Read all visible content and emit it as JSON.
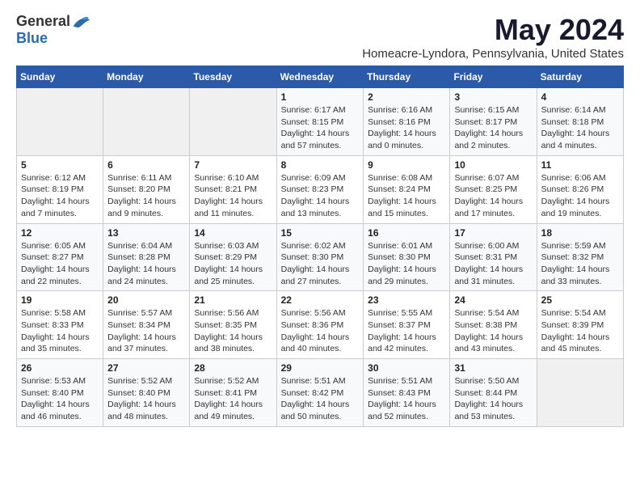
{
  "header": {
    "logo_general": "General",
    "logo_blue": "Blue",
    "title": "May 2024",
    "subtitle": "Homeacre-Lyndora, Pennsylvania, United States"
  },
  "calendar": {
    "days_of_week": [
      "Sunday",
      "Monday",
      "Tuesday",
      "Wednesday",
      "Thursday",
      "Friday",
      "Saturday"
    ],
    "weeks": [
      [
        {
          "day": "",
          "info": ""
        },
        {
          "day": "",
          "info": ""
        },
        {
          "day": "",
          "info": ""
        },
        {
          "day": "1",
          "info": "Sunrise: 6:17 AM\nSunset: 8:15 PM\nDaylight: 14 hours\nand 57 minutes."
        },
        {
          "day": "2",
          "info": "Sunrise: 6:16 AM\nSunset: 8:16 PM\nDaylight: 14 hours\nand 0 minutes."
        },
        {
          "day": "3",
          "info": "Sunrise: 6:15 AM\nSunset: 8:17 PM\nDaylight: 14 hours\nand 2 minutes."
        },
        {
          "day": "4",
          "info": "Sunrise: 6:14 AM\nSunset: 8:18 PM\nDaylight: 14 hours\nand 4 minutes."
        }
      ],
      [
        {
          "day": "5",
          "info": "Sunrise: 6:12 AM\nSunset: 8:19 PM\nDaylight: 14 hours\nand 7 minutes."
        },
        {
          "day": "6",
          "info": "Sunrise: 6:11 AM\nSunset: 8:20 PM\nDaylight: 14 hours\nand 9 minutes."
        },
        {
          "day": "7",
          "info": "Sunrise: 6:10 AM\nSunset: 8:21 PM\nDaylight: 14 hours\nand 11 minutes."
        },
        {
          "day": "8",
          "info": "Sunrise: 6:09 AM\nSunset: 8:23 PM\nDaylight: 14 hours\nand 13 minutes."
        },
        {
          "day": "9",
          "info": "Sunrise: 6:08 AM\nSunset: 8:24 PM\nDaylight: 14 hours\nand 15 minutes."
        },
        {
          "day": "10",
          "info": "Sunrise: 6:07 AM\nSunset: 8:25 PM\nDaylight: 14 hours\nand 17 minutes."
        },
        {
          "day": "11",
          "info": "Sunrise: 6:06 AM\nSunset: 8:26 PM\nDaylight: 14 hours\nand 19 minutes."
        }
      ],
      [
        {
          "day": "12",
          "info": "Sunrise: 6:05 AM\nSunset: 8:27 PM\nDaylight: 14 hours\nand 22 minutes."
        },
        {
          "day": "13",
          "info": "Sunrise: 6:04 AM\nSunset: 8:28 PM\nDaylight: 14 hours\nand 24 minutes."
        },
        {
          "day": "14",
          "info": "Sunrise: 6:03 AM\nSunset: 8:29 PM\nDaylight: 14 hours\nand 25 minutes."
        },
        {
          "day": "15",
          "info": "Sunrise: 6:02 AM\nSunset: 8:30 PM\nDaylight: 14 hours\nand 27 minutes."
        },
        {
          "day": "16",
          "info": "Sunrise: 6:01 AM\nSunset: 8:30 PM\nDaylight: 14 hours\nand 29 minutes."
        },
        {
          "day": "17",
          "info": "Sunrise: 6:00 AM\nSunset: 8:31 PM\nDaylight: 14 hours\nand 31 minutes."
        },
        {
          "day": "18",
          "info": "Sunrise: 5:59 AM\nSunset: 8:32 PM\nDaylight: 14 hours\nand 33 minutes."
        }
      ],
      [
        {
          "day": "19",
          "info": "Sunrise: 5:58 AM\nSunset: 8:33 PM\nDaylight: 14 hours\nand 35 minutes."
        },
        {
          "day": "20",
          "info": "Sunrise: 5:57 AM\nSunset: 8:34 PM\nDaylight: 14 hours\nand 37 minutes."
        },
        {
          "day": "21",
          "info": "Sunrise: 5:56 AM\nSunset: 8:35 PM\nDaylight: 14 hours\nand 38 minutes."
        },
        {
          "day": "22",
          "info": "Sunrise: 5:56 AM\nSunset: 8:36 PM\nDaylight: 14 hours\nand 40 minutes."
        },
        {
          "day": "23",
          "info": "Sunrise: 5:55 AM\nSunset: 8:37 PM\nDaylight: 14 hours\nand 42 minutes."
        },
        {
          "day": "24",
          "info": "Sunrise: 5:54 AM\nSunset: 8:38 PM\nDaylight: 14 hours\nand 43 minutes."
        },
        {
          "day": "25",
          "info": "Sunrise: 5:54 AM\nSunset: 8:39 PM\nDaylight: 14 hours\nand 45 minutes."
        }
      ],
      [
        {
          "day": "26",
          "info": "Sunrise: 5:53 AM\nSunset: 8:40 PM\nDaylight: 14 hours\nand 46 minutes."
        },
        {
          "day": "27",
          "info": "Sunrise: 5:52 AM\nSunset: 8:40 PM\nDaylight: 14 hours\nand 48 minutes."
        },
        {
          "day": "28",
          "info": "Sunrise: 5:52 AM\nSunset: 8:41 PM\nDaylight: 14 hours\nand 49 minutes."
        },
        {
          "day": "29",
          "info": "Sunrise: 5:51 AM\nSunset: 8:42 PM\nDaylight: 14 hours\nand 50 minutes."
        },
        {
          "day": "30",
          "info": "Sunrise: 5:51 AM\nSunset: 8:43 PM\nDaylight: 14 hours\nand 52 minutes."
        },
        {
          "day": "31",
          "info": "Sunrise: 5:50 AM\nSunset: 8:44 PM\nDaylight: 14 hours\nand 53 minutes."
        },
        {
          "day": "",
          "info": ""
        }
      ]
    ]
  }
}
